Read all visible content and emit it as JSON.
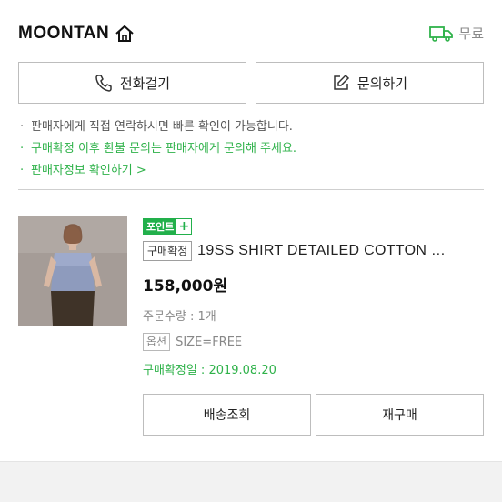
{
  "header": {
    "store_name": "MOONTAN",
    "shipping_label": "무료"
  },
  "actions": {
    "call_label": "전화걸기",
    "inquiry_label": "문의하기"
  },
  "notes": [
    "판매자에게 직접 연락하시면 빠른 확인이 가능합니다.",
    "구매확정 이후 환불 문의는 판매자에게 문의해 주세요.",
    "판매자정보 확인하기 >"
  ],
  "product": {
    "point_badge": "포인트",
    "status_tag": "구매확정",
    "title": "19SS SHIRT DETAILED COTTON …",
    "price": "158,000원",
    "quantity": "주문수량 : 1개",
    "option_tag": "옵션",
    "option_value": "SIZE=FREE",
    "confirm_date": "구매확정일 : 2019.08.20"
  },
  "bottom_buttons": {
    "tracking_label": "배송조회",
    "rebuy_label": "재구매"
  },
  "colors": {
    "accent_green": "#22b04b",
    "text_gray": "#888888"
  }
}
